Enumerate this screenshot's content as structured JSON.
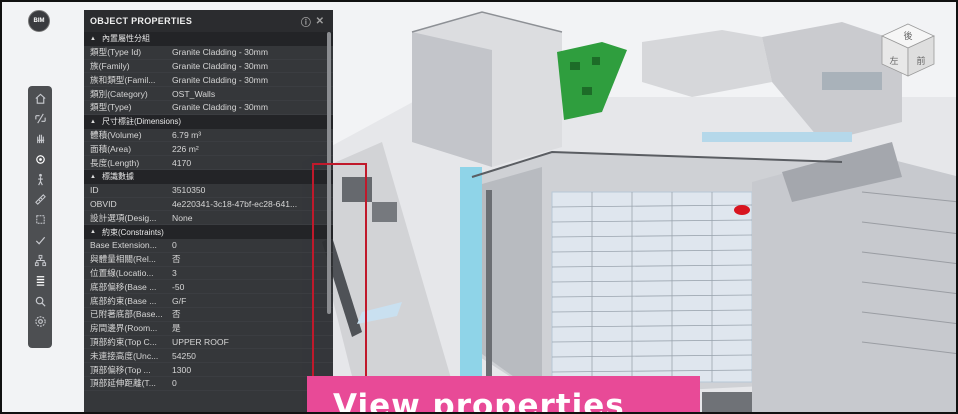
{
  "app": {
    "logo_text": "BIM",
    "accent": "#e84a97",
    "highlight_color": "#c0192b"
  },
  "toolbar": {
    "items": [
      {
        "name": "home-icon"
      },
      {
        "name": "section-icon"
      },
      {
        "name": "pan-hand-icon"
      },
      {
        "name": "orbit-icon"
      },
      {
        "name": "walk-person-icon"
      },
      {
        "name": "measure-ruler-icon"
      },
      {
        "name": "section-box-icon"
      },
      {
        "name": "check-icon"
      },
      {
        "name": "model-tree-icon"
      },
      {
        "name": "properties-list-icon"
      },
      {
        "name": "search-icon"
      },
      {
        "name": "settings-icon"
      }
    ]
  },
  "panel": {
    "title": "OBJECT PROPERTIES",
    "sections": [
      {
        "label": "內置屬性分組",
        "rows": [
          {
            "k": "類型(Type Id)",
            "v": "Granite Cladding - 30mm"
          },
          {
            "k": "族(Family)",
            "v": "Granite Cladding - 30mm"
          },
          {
            "k": "族和類型(Famil...",
            "v": "Granite Cladding - 30mm"
          },
          {
            "k": "類別(Category)",
            "v": "OST_Walls"
          },
          {
            "k": "類型(Type)",
            "v": "Granite Cladding - 30mm"
          }
        ]
      },
      {
        "label": "尺寸標註(Dimensions)",
        "rows": [
          {
            "k": "體積(Volume)",
            "v": "6.79 m³"
          },
          {
            "k": "面積(Area)",
            "v": "226 m²"
          },
          {
            "k": "長度(Length)",
            "v": "4170"
          }
        ]
      },
      {
        "label": "標識數據",
        "rows": [
          {
            "k": "ID",
            "v": "3510350"
          },
          {
            "k": "OBVID",
            "v": "4e220341-3c18-47bf-ec28-641..."
          },
          {
            "k": "設計選項(Desig...",
            "v": "None"
          }
        ]
      },
      {
        "label": "約束(Constraints)",
        "rows": [
          {
            "k": "Base Extension...",
            "v": "0"
          },
          {
            "k": "與體量相關(Rel...",
            "v": "否"
          },
          {
            "k": "位置線(Locatio...",
            "v": "3"
          },
          {
            "k": "底部偏移(Base ...",
            "v": "-50"
          },
          {
            "k": "底部約束(Base ...",
            "v": "G/F"
          },
          {
            "k": "已附著底部(Base...",
            "v": "否"
          },
          {
            "k": "房間邊界(Room...",
            "v": "是"
          },
          {
            "k": "頂部約束(Top C...",
            "v": "UPPER ROOF"
          },
          {
            "k": "未連接高度(Unc...",
            "v": "54250"
          },
          {
            "k": "頂部偏移(Top ...",
            "v": "1300"
          },
          {
            "k": "頂部延伸距離(T...",
            "v": "0"
          }
        ]
      }
    ]
  },
  "viewcube": {
    "face_top": "後",
    "face_left": "左",
    "face_right": "前"
  },
  "callout": {
    "text": "View properties"
  }
}
